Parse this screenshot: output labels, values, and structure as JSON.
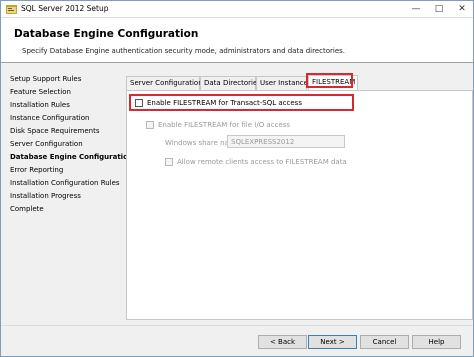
{
  "window": {
    "title": "SQL Server 2012 Setup",
    "icons": {
      "app": "sql-server-setup-icon",
      "minimize": "minimize-icon",
      "maximize": "maximize-icon",
      "close": "close-icon"
    },
    "controls": {
      "minimize": "—",
      "maximize": "□",
      "close": "✕"
    }
  },
  "header": {
    "title": "Database Engine Configuration",
    "subtitle": "Specify Database Engine authentication security mode, administrators and data directories."
  },
  "sidebar": {
    "items": [
      {
        "label": "Setup Support Rules",
        "active": false
      },
      {
        "label": "Feature Selection",
        "active": false
      },
      {
        "label": "Installation Rules",
        "active": false
      },
      {
        "label": "Instance Configuration",
        "active": false
      },
      {
        "label": "Disk Space Requirements",
        "active": false
      },
      {
        "label": "Server Configuration",
        "active": false
      },
      {
        "label": "Database Engine Configuration",
        "active": true
      },
      {
        "label": "Error Reporting",
        "active": false
      },
      {
        "label": "Installation Configuration Rules",
        "active": false
      },
      {
        "label": "Installation Progress",
        "active": false
      },
      {
        "label": "Complete",
        "active": false
      }
    ]
  },
  "tabs": [
    {
      "label": "Server Configuration"
    },
    {
      "label": "Data Directories"
    },
    {
      "label": "User Instances"
    },
    {
      "label": "FILESTREAM",
      "selected": true
    }
  ],
  "filestream": {
    "enable_tsql_label": "Enable FILESTREAM for Transact-SQL access",
    "enable_tsql_checked": false,
    "enable_file_io_label": "Enable FILESTREAM for file I/O access",
    "enable_file_io_checked": false,
    "share_name_label": "Windows share name:",
    "share_name_value": "SQLEXPRESS2012",
    "allow_remote_label": "Allow remote clients access to FILESTREAM data",
    "allow_remote_checked": false
  },
  "footer": {
    "back_label": "< Back",
    "next_label": "Next >",
    "cancel_label": "Cancel",
    "help_label": "Help"
  },
  "colors": {
    "highlight_border": "#d9282f",
    "window_bg": "#f0f0f0",
    "disabled_text": "#9a9a9a"
  }
}
